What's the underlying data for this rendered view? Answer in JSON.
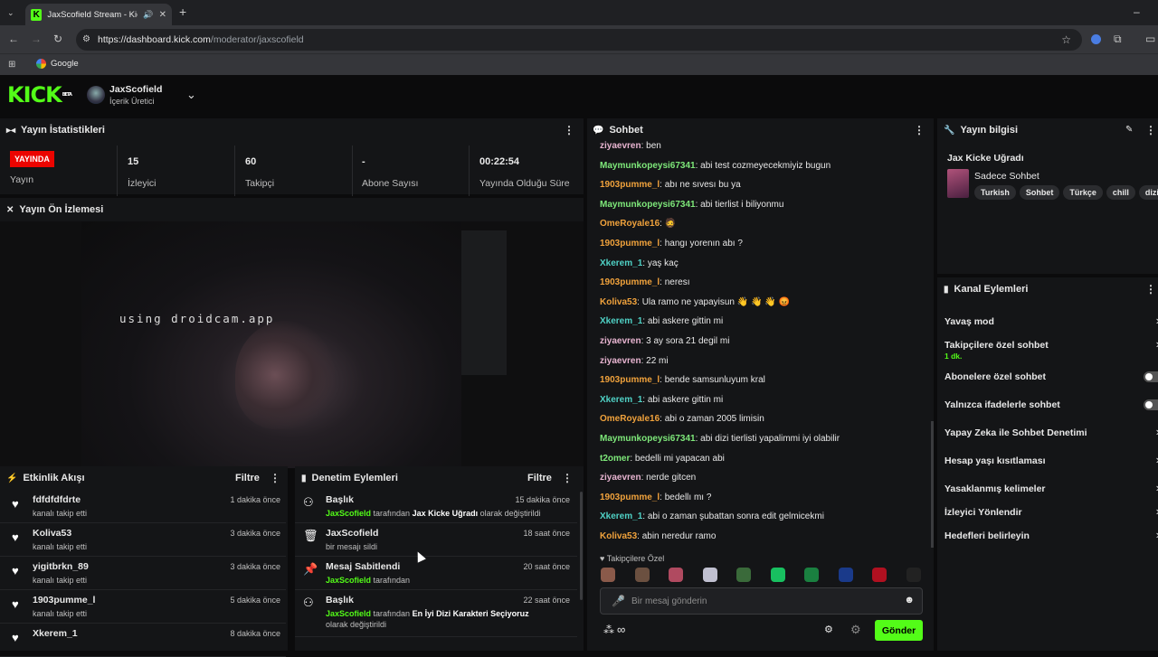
{
  "browser": {
    "tab_title": "JaxScofield Stream - Kick Da",
    "url_host": "https://dashboard.kick.com",
    "url_path": "/moderator/jaxscofield",
    "bookmark": "Google"
  },
  "header": {
    "logo": "KICK",
    "logo_badge": "BETA",
    "channel_name": "JaxScofield",
    "channel_role": "İçerik Üretici"
  },
  "stats": {
    "title": "Yayın İstatistikleri",
    "live_badge": "YAYINDA",
    "live_label": "Yayın",
    "viewers_value": "15",
    "viewers_label": "İzleyici",
    "followers_value": "60",
    "followers_label": "Takipçi",
    "subs_value": "-",
    "subs_label": "Abone Sayısı",
    "uptime_value": "00:22:54",
    "uptime_label": "Yayında Olduğu Süre"
  },
  "preview": {
    "title": "Yayın Ön İzlemesi",
    "overlay_text": "using droidcam.app"
  },
  "activity": {
    "title": "Etkinlik Akışı",
    "filter": "Filtre",
    "items": [
      {
        "name": "fdfdfdfdrte",
        "sub": "kanalı takip etti",
        "time": "1 dakika önce"
      },
      {
        "name": "Koliva53",
        "sub": "kanalı takip etti",
        "time": "3 dakika önce"
      },
      {
        "name": "yigitbrkn_89",
        "sub": "kanalı takip etti",
        "time": "3 dakika önce"
      },
      {
        "name": "1903pumme_l",
        "sub": "kanalı takip etti",
        "time": "5 dakika önce"
      },
      {
        "name": "Xkerem_1",
        "sub": "",
        "time": "8 dakika önce"
      }
    ]
  },
  "moderation": {
    "title": "Denetim Eylemleri",
    "filter": "Filtre",
    "items": [
      {
        "name": "Başlık",
        "user": "JaxScofield",
        "mid": " tarafından ",
        "val": "Jax Kicke Uğradı",
        "end": " olarak değiştirildi",
        "time": "15 dakika önce"
      },
      {
        "name": "JaxScofield",
        "user": "",
        "mid": "bir mesajı sildi",
        "val": "",
        "end": "",
        "time": "18 saat önce"
      },
      {
        "name": "Mesaj Sabitlendi",
        "user": "JaxScofield",
        "mid": " tarafından",
        "val": "",
        "end": "",
        "time": "20 saat önce"
      },
      {
        "name": "Başlık",
        "user": "JaxScofield",
        "mid": " tarafından ",
        "val": "En İyi Dizi Karakteri Seçiyoruz",
        "end": " olarak değiştirildi",
        "time": "22 saat önce"
      }
    ]
  },
  "chat": {
    "title": "Sohbet",
    "messages": [
      {
        "user": "ziyaevren",
        "color": "#e7b4d0",
        "text": ": ben"
      },
      {
        "user": "Maymunkopeysi67341",
        "color": "#7ee87a",
        "text": ": abi test cozmeyecekmiyiz bugun"
      },
      {
        "user": "1903pumme_l",
        "color": "#f0a23c",
        "text": ": abı ne sıvesı bu ya"
      },
      {
        "user": "Maymunkopeysi67341",
        "color": "#7ee87a",
        "text": ": abi tierlist i biliyonmu"
      },
      {
        "user": "OmeRoyale16",
        "color": "#f0a23c",
        "text": ": 🧔"
      },
      {
        "user": "1903pumme_l",
        "color": "#f0a23c",
        "text": ": hangı yorenın abı ?"
      },
      {
        "user": "Xkerem_1",
        "color": "#4fd1c5",
        "text": ": yaş kaç"
      },
      {
        "user": "1903pumme_l",
        "color": "#f0a23c",
        "text": ": neresı"
      },
      {
        "user": "Koliva53",
        "color": "#f0a23c",
        "text": ": Ula ramo ne yapayisun 👋 👋 👋 😡"
      },
      {
        "user": "Xkerem_1",
        "color": "#4fd1c5",
        "text": ": abi askere gittin mi"
      },
      {
        "user": "ziyaevren",
        "color": "#e7b4d0",
        "text": ": 3 ay sora 21 degil mi"
      },
      {
        "user": "ziyaevren",
        "color": "#e7b4d0",
        "text": ": 22 mi"
      },
      {
        "user": "1903pumme_l",
        "color": "#f0a23c",
        "text": ": bende samsunluyum kral"
      },
      {
        "user": "Xkerem_1",
        "color": "#4fd1c5",
        "text": ": abi askere gittin mi"
      },
      {
        "user": "OmeRoyale16",
        "color": "#f0a23c",
        "text": ": abi o zaman 2005 limisin"
      },
      {
        "user": "Maymunkopeysi67341",
        "color": "#7ee87a",
        "text": ": abi dizi tierlisti yapalimmi iyi olabilir"
      },
      {
        "user": "t2omer",
        "color": "#7ee87a",
        "text": ": bedelli mi yapacan abi"
      },
      {
        "user": "ziyaevren",
        "color": "#e7b4d0",
        "text": ": nerde gitcen"
      },
      {
        "user": "1903pumme_l",
        "color": "#f0a23c",
        "text": ": bedellı mı ?"
      },
      {
        "user": "Xkerem_1",
        "color": "#4fd1c5",
        "text": ": abi o zaman şubattan sonra edit gelmicekmi"
      },
      {
        "user": "Koliva53",
        "color": "#f0a23c",
        "text": ": abin neredur ramo"
      }
    ],
    "emote_label": "Takipçilere Özel",
    "input_placeholder": "Bir mesaj gönderin",
    "send": "Gönder",
    "points": "∞"
  },
  "stream_info": {
    "title": "Yayın bilgisi",
    "stream_title": "Jax Kicke Uğradı",
    "category": "Sadece Sohbet",
    "tags": [
      "Turkish",
      "Sohbet",
      "Türkçe",
      "chill",
      "dizi"
    ]
  },
  "channel_actions": {
    "title": "Kanal Eylemleri",
    "items": [
      {
        "label": "Yavaş mod",
        "sub": "",
        "kind": "chevron"
      },
      {
        "label": "Takipçilere özel sohbet",
        "sub": "1 dk.",
        "kind": "chevron"
      },
      {
        "label": "Abonelere özel sohbet",
        "sub": "",
        "kind": "toggle"
      },
      {
        "label": "Yalnızca ifadelerle sohbet",
        "sub": "",
        "kind": "toggle"
      },
      {
        "label": "Yapay Zeka ile Sohbet Denetimi",
        "sub": "",
        "kind": "chevron"
      },
      {
        "label": "Hesap yaşı kısıtlaması",
        "sub": "",
        "kind": "chevron"
      },
      {
        "label": "Yasaklanmış kelimeler",
        "sub": "",
        "kind": "chevron"
      },
      {
        "label": "İzleyici Yönlendir",
        "sub": "",
        "kind": "chevron"
      },
      {
        "label": "Hedefleri belirleyin",
        "sub": "",
        "kind": "chevron"
      }
    ]
  },
  "colors": {
    "accent": "#53fc18",
    "live": "#eb0400",
    "panel": "#141517"
  }
}
